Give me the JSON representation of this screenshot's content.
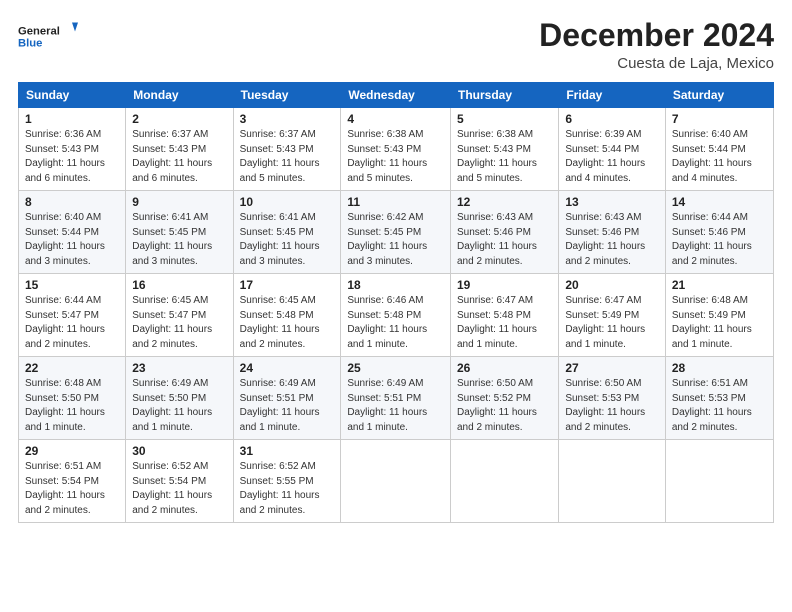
{
  "header": {
    "logo_line1": "General",
    "logo_line2": "Blue",
    "month": "December 2024",
    "location": "Cuesta de Laja, Mexico"
  },
  "days_of_week": [
    "Sunday",
    "Monday",
    "Tuesday",
    "Wednesday",
    "Thursday",
    "Friday",
    "Saturday"
  ],
  "weeks": [
    [
      {
        "day": "1",
        "sunrise": "6:36 AM",
        "sunset": "5:43 PM",
        "daylight": "11 hours and 6 minutes."
      },
      {
        "day": "2",
        "sunrise": "6:37 AM",
        "sunset": "5:43 PM",
        "daylight": "11 hours and 6 minutes."
      },
      {
        "day": "3",
        "sunrise": "6:37 AM",
        "sunset": "5:43 PM",
        "daylight": "11 hours and 5 minutes."
      },
      {
        "day": "4",
        "sunrise": "6:38 AM",
        "sunset": "5:43 PM",
        "daylight": "11 hours and 5 minutes."
      },
      {
        "day": "5",
        "sunrise": "6:38 AM",
        "sunset": "5:43 PM",
        "daylight": "11 hours and 5 minutes."
      },
      {
        "day": "6",
        "sunrise": "6:39 AM",
        "sunset": "5:44 PM",
        "daylight": "11 hours and 4 minutes."
      },
      {
        "day": "7",
        "sunrise": "6:40 AM",
        "sunset": "5:44 PM",
        "daylight": "11 hours and 4 minutes."
      }
    ],
    [
      {
        "day": "8",
        "sunrise": "6:40 AM",
        "sunset": "5:44 PM",
        "daylight": "11 hours and 3 minutes."
      },
      {
        "day": "9",
        "sunrise": "6:41 AM",
        "sunset": "5:45 PM",
        "daylight": "11 hours and 3 minutes."
      },
      {
        "day": "10",
        "sunrise": "6:41 AM",
        "sunset": "5:45 PM",
        "daylight": "11 hours and 3 minutes."
      },
      {
        "day": "11",
        "sunrise": "6:42 AM",
        "sunset": "5:45 PM",
        "daylight": "11 hours and 3 minutes."
      },
      {
        "day": "12",
        "sunrise": "6:43 AM",
        "sunset": "5:46 PM",
        "daylight": "11 hours and 2 minutes."
      },
      {
        "day": "13",
        "sunrise": "6:43 AM",
        "sunset": "5:46 PM",
        "daylight": "11 hours and 2 minutes."
      },
      {
        "day": "14",
        "sunrise": "6:44 AM",
        "sunset": "5:46 PM",
        "daylight": "11 hours and 2 minutes."
      }
    ],
    [
      {
        "day": "15",
        "sunrise": "6:44 AM",
        "sunset": "5:47 PM",
        "daylight": "11 hours and 2 minutes."
      },
      {
        "day": "16",
        "sunrise": "6:45 AM",
        "sunset": "5:47 PM",
        "daylight": "11 hours and 2 minutes."
      },
      {
        "day": "17",
        "sunrise": "6:45 AM",
        "sunset": "5:48 PM",
        "daylight": "11 hours and 2 minutes."
      },
      {
        "day": "18",
        "sunrise": "6:46 AM",
        "sunset": "5:48 PM",
        "daylight": "11 hours and 1 minute."
      },
      {
        "day": "19",
        "sunrise": "6:47 AM",
        "sunset": "5:48 PM",
        "daylight": "11 hours and 1 minute."
      },
      {
        "day": "20",
        "sunrise": "6:47 AM",
        "sunset": "5:49 PM",
        "daylight": "11 hours and 1 minute."
      },
      {
        "day": "21",
        "sunrise": "6:48 AM",
        "sunset": "5:49 PM",
        "daylight": "11 hours and 1 minute."
      }
    ],
    [
      {
        "day": "22",
        "sunrise": "6:48 AM",
        "sunset": "5:50 PM",
        "daylight": "11 hours and 1 minute."
      },
      {
        "day": "23",
        "sunrise": "6:49 AM",
        "sunset": "5:50 PM",
        "daylight": "11 hours and 1 minute."
      },
      {
        "day": "24",
        "sunrise": "6:49 AM",
        "sunset": "5:51 PM",
        "daylight": "11 hours and 1 minute."
      },
      {
        "day": "25",
        "sunrise": "6:49 AM",
        "sunset": "5:51 PM",
        "daylight": "11 hours and 1 minute."
      },
      {
        "day": "26",
        "sunrise": "6:50 AM",
        "sunset": "5:52 PM",
        "daylight": "11 hours and 2 minutes."
      },
      {
        "day": "27",
        "sunrise": "6:50 AM",
        "sunset": "5:53 PM",
        "daylight": "11 hours and 2 minutes."
      },
      {
        "day": "28",
        "sunrise": "6:51 AM",
        "sunset": "5:53 PM",
        "daylight": "11 hours and 2 minutes."
      }
    ],
    [
      {
        "day": "29",
        "sunrise": "6:51 AM",
        "sunset": "5:54 PM",
        "daylight": "11 hours and 2 minutes."
      },
      {
        "day": "30",
        "sunrise": "6:52 AM",
        "sunset": "5:54 PM",
        "daylight": "11 hours and 2 minutes."
      },
      {
        "day": "31",
        "sunrise": "6:52 AM",
        "sunset": "5:55 PM",
        "daylight": "11 hours and 2 minutes."
      },
      null,
      null,
      null,
      null
    ]
  ],
  "labels": {
    "sunrise": "Sunrise:",
    "sunset": "Sunset:",
    "daylight": "Daylight:"
  }
}
